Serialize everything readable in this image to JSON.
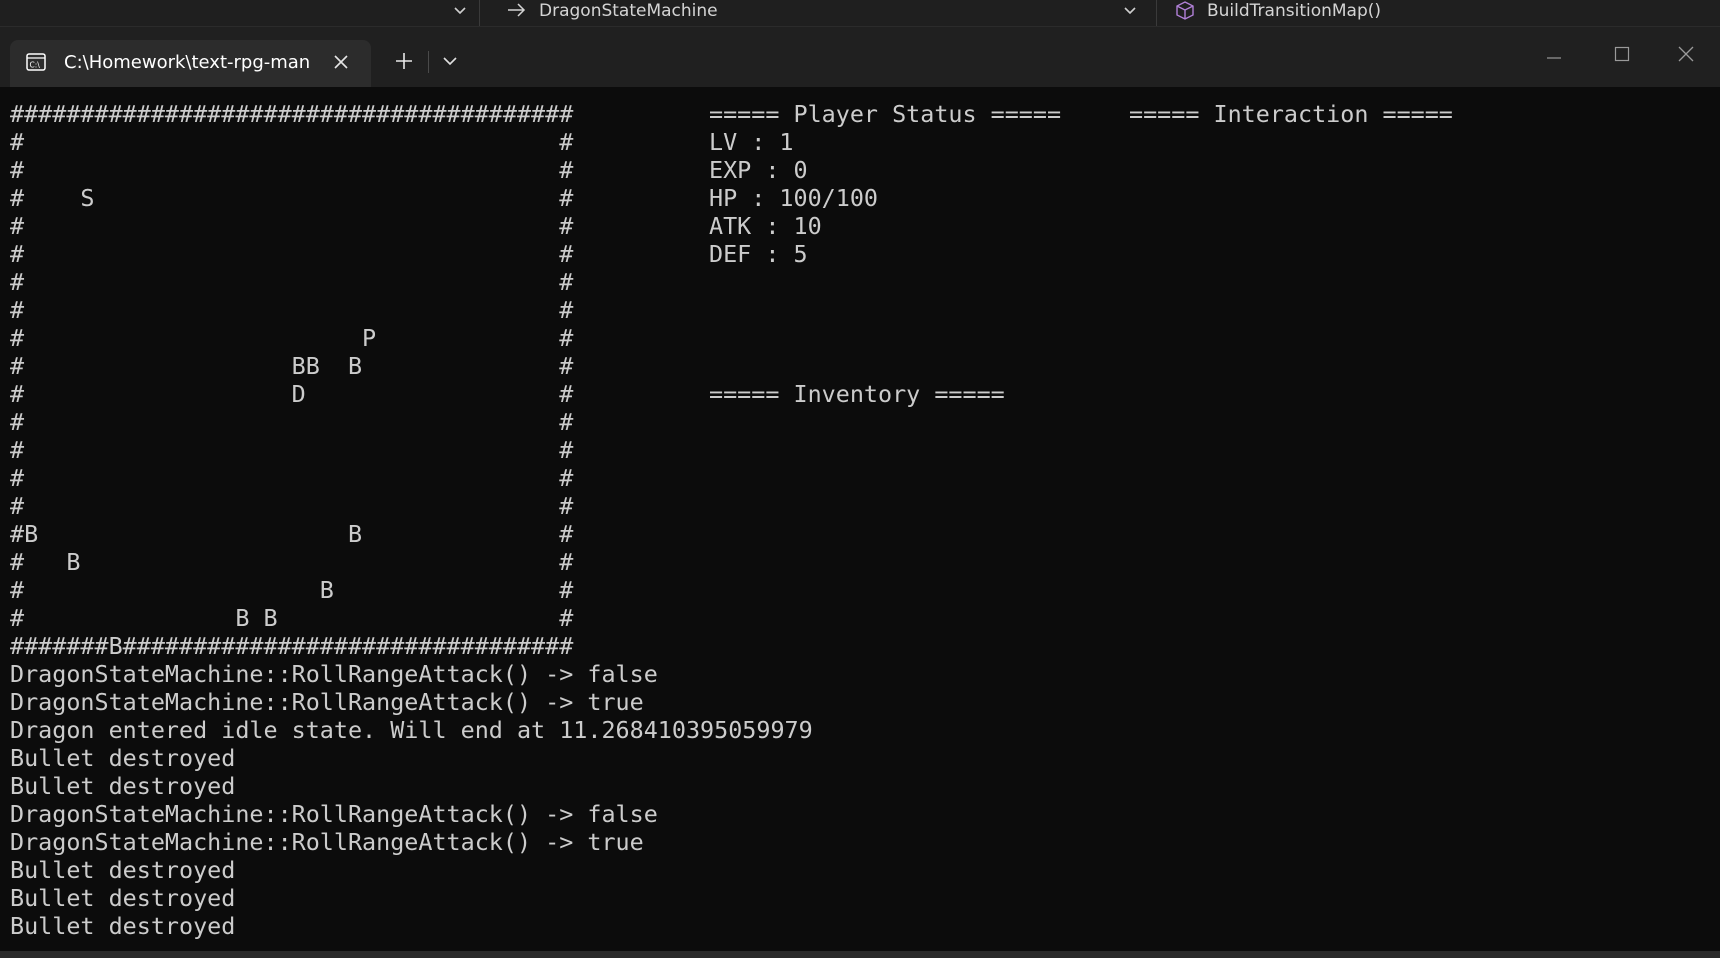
{
  "editor_bar": {
    "breadcrumb_class": "DragonStateMachine",
    "breadcrumb_method": "BuildTransitionMap()"
  },
  "icons": {
    "terminal": "cmd-icon",
    "close": "close-icon",
    "new_tab": "plus-icon",
    "dropdown": "chevron-down-icon",
    "minimize": "minimize-icon",
    "maximize": "maximize-icon",
    "window_close": "close-icon"
  },
  "colors": {
    "console_bg": "#0c0c0c",
    "console_text": "#cccccc",
    "tab_bg": "#2c2c2c",
    "titlebar_bg": "#202020",
    "method_icon": "#b180d7"
  },
  "tab": {
    "title": "C:\\Homework\\text-rpg-man"
  },
  "console": {
    "map_lines": [
      "########################################",
      "#                                      #",
      "#                                      #",
      "#    S                                 #",
      "#                                      #",
      "#                                      #",
      "#                                      #",
      "#                                      #",
      "#                        P             #",
      "#                   BB  B              #",
      "#                   D                  #",
      "#                                      #",
      "#                                      #",
      "#                                      #",
      "#                                      #",
      "#B                      B              #",
      "#   B                                  #",
      "#                     B                #",
      "#               B B                    #",
      "#######B################################"
    ],
    "status_lines": [
      "===== Player Status =====",
      "LV : 1",
      "EXP : 0",
      "HP : 100/100",
      "ATK : 10",
      "DEF : 5",
      "",
      "",
      "",
      "",
      "===== Inventory ====="
    ],
    "interaction_header": "===== Interaction =====",
    "log_lines": [
      "DragonStateMachine::RollRangeAttack() -> false",
      "DragonStateMachine::RollRangeAttack() -> true",
      "Dragon entered idle state. Will end at 11.268410395059979",
      "Bullet destroyed",
      "Bullet destroyed",
      "DragonStateMachine::RollRangeAttack() -> false",
      "DragonStateMachine::RollRangeAttack() -> true",
      "Bullet destroyed",
      "Bullet destroyed",
      "Bullet destroyed"
    ]
  }
}
